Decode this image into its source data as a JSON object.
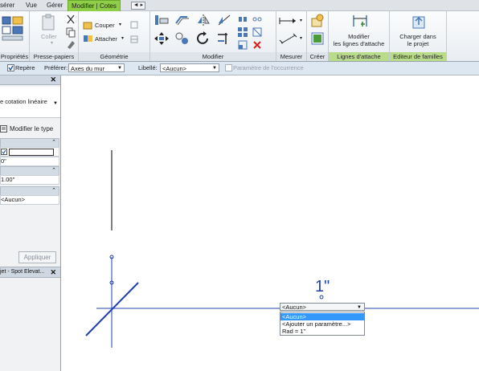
{
  "tabs": {
    "insert": "sérer",
    "view": "Vue",
    "manage": "Gérer",
    "modify_dim": "Modifier | Cotes",
    "extra": "◄ ▸"
  },
  "ribbon": {
    "properties_label": "Propriétés",
    "clipboard_label": "Presse-papiers",
    "paste_label": "Coller",
    "geometry_label": "Géométrie",
    "cut_label": "Couper",
    "join_label": "Attacher",
    "modify_label": "Modifier",
    "measure_label": "Mesurer",
    "create_label": "Créer",
    "witness_label": "Lignes d'attache",
    "modify_witness_1": "Modifier",
    "modify_witness_2": "les lignes d'attache",
    "family_label": "Editeur de familles",
    "load_1": "Charger dans",
    "load_2": "le projet"
  },
  "options": {
    "repere_label": "Repère",
    "prefer_label": "Préférer:",
    "prefer_value": "Axes du mur",
    "libelle_label": "Libellé:",
    "libelle_value": "<Aucun>",
    "instance_param": "Paramètre de l'occurrence"
  },
  "properties": {
    "type_name": "e cotation linéaire",
    "edit_type": "Modifier le type",
    "row_check": "",
    "row_val1": "0\"",
    "row_val2": "1.00\"",
    "row_val3": "<Aucun>",
    "apply": "Appliquer",
    "browser_title": "jet - Spot Elevat..."
  },
  "canvas": {
    "dim_value": "1\"",
    "dropdown_value": "<Aucun>",
    "options": [
      "<Aucun>",
      "<Ajouter un paramètre...>",
      "Rad = 1\""
    ]
  }
}
